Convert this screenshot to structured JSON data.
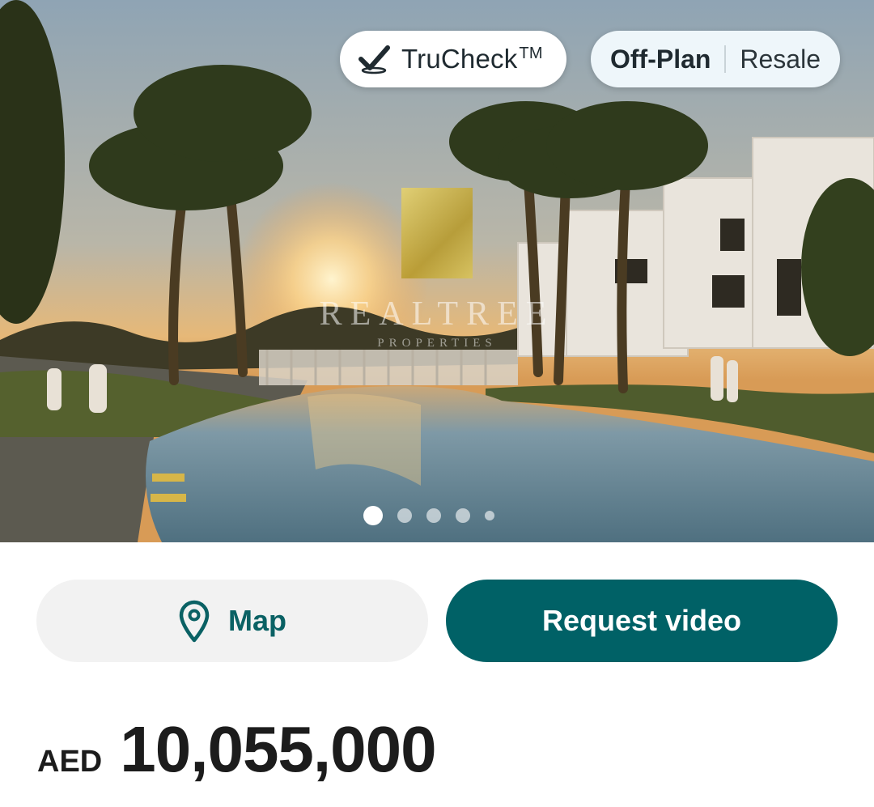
{
  "badges": {
    "trucheck_label": "TruCheck",
    "trucheck_tm": "TM",
    "trucheck_icon": "check-icon"
  },
  "listing_type": {
    "options": [
      "Off-Plan",
      "Resale"
    ],
    "selected": "Off-Plan"
  },
  "gallery": {
    "current_index": 1,
    "total_dots": 5,
    "watermark": {
      "brand": "REALTREE",
      "sub": "PROPERTIES"
    }
  },
  "actions": {
    "map_label": "Map",
    "map_icon": "map-pin-icon",
    "request_video_label": "Request video"
  },
  "price": {
    "currency": "AED",
    "amount": "10,055,000"
  },
  "colors": {
    "brand_teal": "#006166",
    "map_text": "#0a6164",
    "map_button_bg": "#f2f2f2"
  }
}
